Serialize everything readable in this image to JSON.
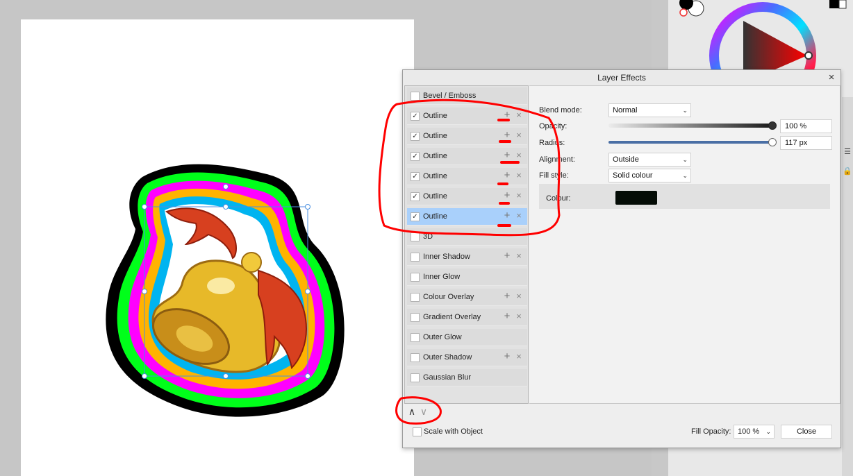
{
  "dialog": {
    "title": "Layer Effects",
    "close_icon": "close-icon"
  },
  "effects": [
    {
      "label": "Bevel / Emboss",
      "checked": false,
      "selected": false,
      "has_actions": false
    },
    {
      "label": "Outline",
      "checked": true,
      "selected": false,
      "has_actions": true
    },
    {
      "label": "Outline",
      "checked": true,
      "selected": false,
      "has_actions": true
    },
    {
      "label": "Outline",
      "checked": true,
      "selected": false,
      "has_actions": true
    },
    {
      "label": "Outline",
      "checked": true,
      "selected": false,
      "has_actions": true
    },
    {
      "label": "Outline",
      "checked": true,
      "selected": false,
      "has_actions": true
    },
    {
      "label": "Outline",
      "checked": true,
      "selected": true,
      "has_actions": true
    },
    {
      "label": "3D",
      "checked": false,
      "selected": false,
      "has_actions": false
    },
    {
      "label": "Inner Shadow",
      "checked": false,
      "selected": false,
      "has_actions": true
    },
    {
      "label": "Inner Glow",
      "checked": false,
      "selected": false,
      "has_actions": false
    },
    {
      "label": "Colour Overlay",
      "checked": false,
      "selected": false,
      "has_actions": true
    },
    {
      "label": "Gradient Overlay",
      "checked": false,
      "selected": false,
      "has_actions": true
    },
    {
      "label": "Outer Glow",
      "checked": false,
      "selected": false,
      "has_actions": false
    },
    {
      "label": "Outer Shadow",
      "checked": false,
      "selected": false,
      "has_actions": true
    },
    {
      "label": "Gaussian Blur",
      "checked": false,
      "selected": false,
      "has_actions": false
    }
  ],
  "settings": {
    "blend_mode_label": "Blend mode:",
    "blend_mode_value": "Normal",
    "opacity_label": "Opacity:",
    "opacity_value": "100 %",
    "opacity_fraction": 1.0,
    "radius_label": "Radius:",
    "radius_value": "117 px",
    "alignment_label": "Alignment:",
    "alignment_value": "Outside",
    "fill_style_label": "Fill style:",
    "fill_style_value": "Solid colour",
    "colour_label": "Colour:",
    "colour_hex": "#040c06"
  },
  "footer": {
    "scale_label": "Scale with Object",
    "fill_opacity_label": "Fill Opacity:",
    "fill_opacity_value": "100 %",
    "close_label": "Close"
  },
  "icons": {
    "add": "+",
    "remove": "×",
    "check": "✓",
    "up": "∧",
    "down": "∨",
    "chevron": "⌄"
  },
  "colors": {
    "selection": "#a9d0fb",
    "annotation": "#ff0000",
    "outline_black": "#000000",
    "outline_green": "#00ff1a",
    "outline_magenta": "#ff00ff",
    "outline_orange": "#ffb300",
    "outline_cyan": "#00b4f0",
    "outline_white": "#ffffff"
  }
}
